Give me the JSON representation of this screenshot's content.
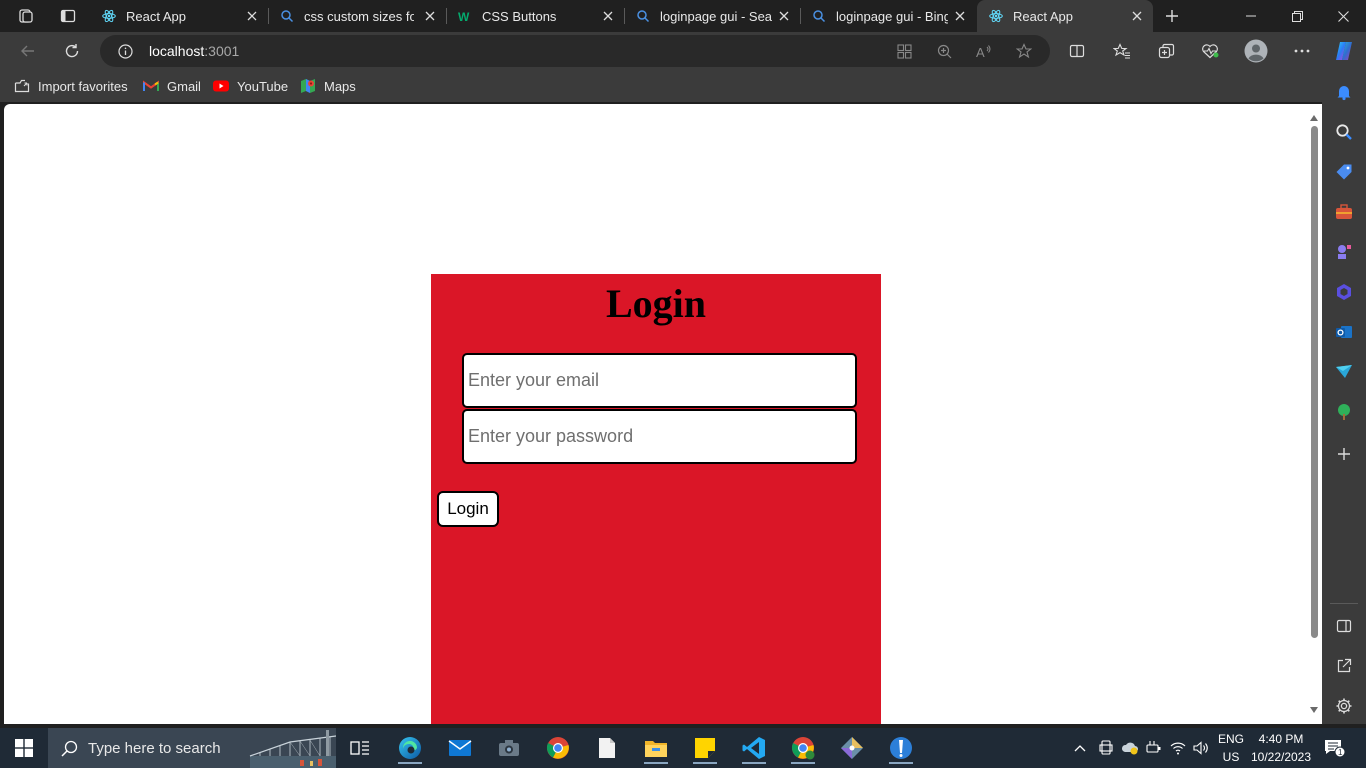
{
  "browser": {
    "tabs": [
      {
        "title": "React App",
        "icon": "react-icon",
        "active": false
      },
      {
        "title": "css custom sizes for b",
        "icon": "search-icon",
        "active": false
      },
      {
        "title": "CSS Buttons",
        "icon": "w3schools-icon",
        "active": false
      },
      {
        "title": "loginpage gui - Searc",
        "icon": "search-icon",
        "active": false
      },
      {
        "title": "loginpage gui - Bing",
        "icon": "search-icon",
        "active": false
      },
      {
        "title": "React App",
        "icon": "react-icon",
        "active": true
      }
    ],
    "address": {
      "host": "localhost",
      "port": ":3001"
    },
    "favorites": [
      {
        "label": "Import favorites",
        "icon": "import-icon"
      },
      {
        "label": "Gmail",
        "icon": "gmail-icon"
      },
      {
        "label": "YouTube",
        "icon": "youtube-icon"
      },
      {
        "label": "Maps",
        "icon": "maps-icon"
      }
    ]
  },
  "page": {
    "heading": "Login",
    "email_placeholder": "Enter your email",
    "password_placeholder": "Enter your password",
    "login_button": "Login",
    "card_color": "#da1627"
  },
  "taskbar": {
    "search_placeholder": "Type here to search",
    "language": "ENG",
    "region": "US",
    "time": "4:40 PM",
    "date": "10/22/2023",
    "notification_count": "1"
  }
}
